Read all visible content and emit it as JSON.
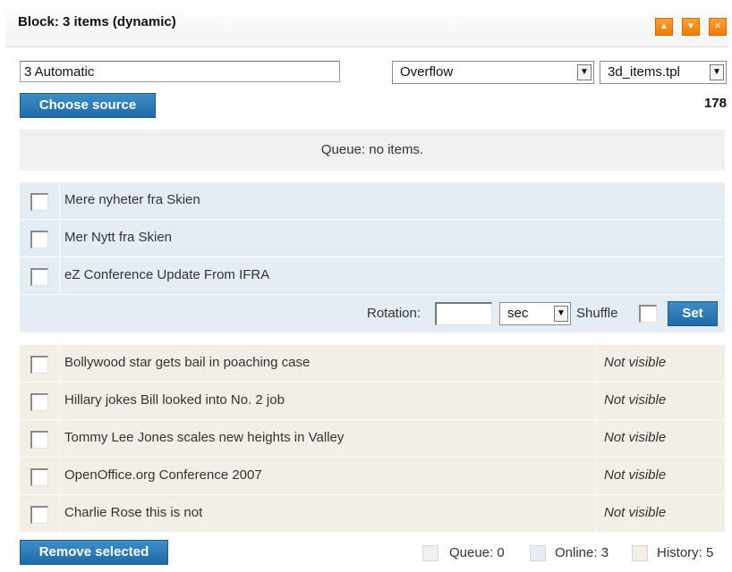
{
  "header": {
    "title": "Block: 3 items (dynamic)",
    "buttons": [
      "chevron-up-icon",
      "chevron-down-icon",
      "close-icon"
    ],
    "accent_color": "#f47a00"
  },
  "source": {
    "name_value": "3 Automatic",
    "overflow_select": "Overflow",
    "template_select": "3d_items.tpl",
    "choose_source_label": "Choose source",
    "count": "178"
  },
  "queue": {
    "message": "Queue: no items."
  },
  "online": {
    "items": [
      {
        "title": "Mere nyheter fra Skien"
      },
      {
        "title": "Mer Nytt fra Skien"
      },
      {
        "title": "eZ Conference Update From IFRA"
      }
    ],
    "rotation_label": "Rotation:",
    "rotation_value": "",
    "rotation_unit": "sec",
    "shuffle_label": "Shuffle",
    "set_label": "Set"
  },
  "history": {
    "items": [
      {
        "title": "Bollywood star gets bail in poaching case",
        "status": "Not visible"
      },
      {
        "title": "Hillary jokes Bill looked into No. 2 job",
        "status": "Not visible"
      },
      {
        "title": "Tommy Lee Jones scales new heights in Valley",
        "status": "Not visible"
      },
      {
        "title": "OpenOffice.org Conference 2007",
        "status": "Not visible"
      },
      {
        "title": "Charlie Rose this is not",
        "status": "Not visible"
      }
    ]
  },
  "footer": {
    "remove_label": "Remove selected",
    "legend": [
      {
        "label": "Queue: 0",
        "color": "#f0f0f0"
      },
      {
        "label": "Online: 3",
        "color": "#e4edf4"
      },
      {
        "label": "History: 5",
        "color": "#f3efe6"
      }
    ]
  }
}
